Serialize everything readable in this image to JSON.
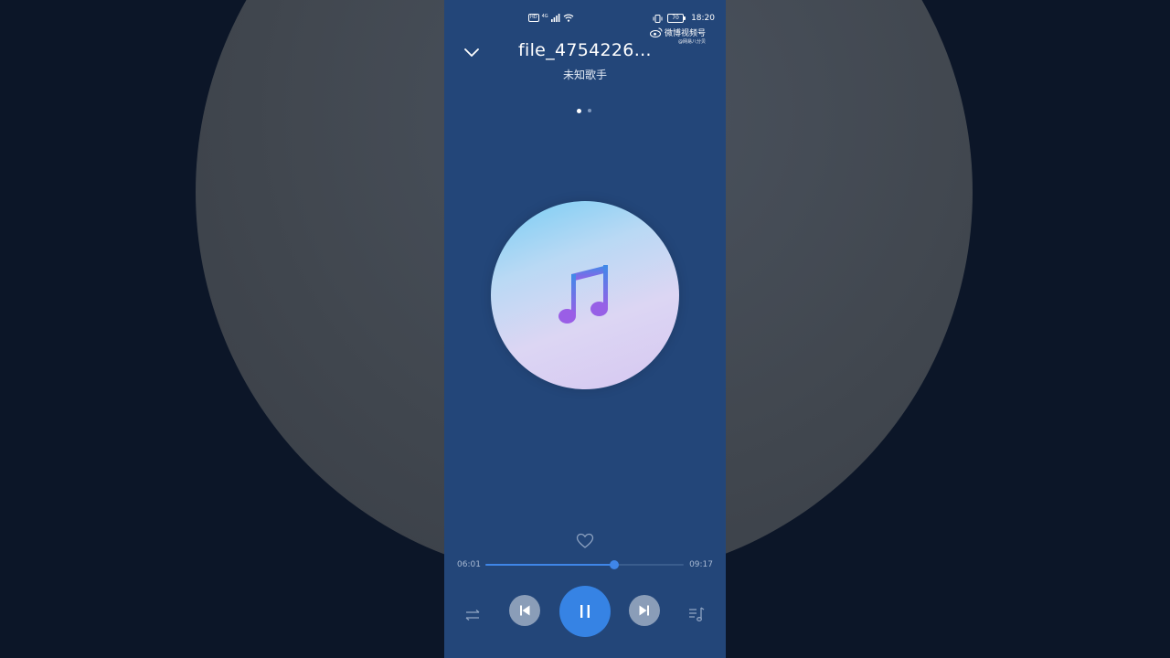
{
  "status_bar": {
    "hd_badge": "HD",
    "network": "4G",
    "battery_level": "70",
    "time": "18:20"
  },
  "watermark": {
    "brand": "微博视频号",
    "sub": "@网易八分贝"
  },
  "player": {
    "title": "file_4754226…",
    "artist": "未知歌手",
    "pages": 2,
    "active_page": 0,
    "elapsed": "06:01",
    "total": "09:17",
    "progress": 0.648
  },
  "icons": {
    "collapse": "chevron-down-icon",
    "note": "music-note-icon",
    "like": "heart-icon",
    "mode": "repeat-icon",
    "prev": "skip-previous-icon",
    "play_pause": "pause-icon",
    "next": "skip-next-icon",
    "playlist": "playlist-icon"
  },
  "colors": {
    "phone_bg": "#234679",
    "accent": "#3683e4",
    "secondary_button": "#8a9db8"
  }
}
